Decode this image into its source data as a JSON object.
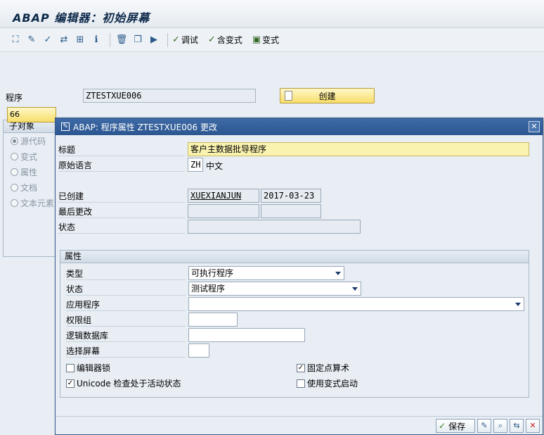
{
  "window": {
    "title": "ABAP 编辑器：初始屏幕"
  },
  "toolbar": {
    "debug_label": "调试",
    "with_variant_label": "含变式",
    "variant_label": "变式"
  },
  "main": {
    "program_label": "程序",
    "program_value": "ZTESTXUE006",
    "create_label": "创建",
    "subobjects_header": "子对象",
    "subobjects": [
      "源代码",
      "变式",
      "属性",
      "文档",
      "文本元素"
    ],
    "subobject_button": "66"
  },
  "dialog": {
    "title": "ABAP: 程序属性 ZTESTXUE006 更改",
    "title_label": "标题",
    "title_value": "客户主数据批导程序",
    "orig_lang_label": "原始语言",
    "orig_lang_code": "ZH",
    "orig_lang_name": "中文",
    "created_label": "已创建",
    "created_by": "XUEXIANJUN",
    "created_date": "2017-03-23",
    "last_changed_label": "最后更改",
    "status_label": "状态",
    "attributes": {
      "header": "属性",
      "type_label": "类型",
      "type_value": "可执行程序",
      "status_label": "状态",
      "status_value": "测试程序",
      "application_label": "应用程序",
      "authgroup_label": "权限组",
      "logical_db_label": "逻辑数据库",
      "selection_screen_label": "选择屏幕",
      "editor_lock_label": "编辑器锁",
      "fixed_point_label": "固定点算术",
      "unicode_label": "Unicode 检查处于活动状态",
      "start_variant_label": "使用变式启动",
      "editor_lock": false,
      "fixed_point": true,
      "unicode": true,
      "start_variant": false
    },
    "save_label": "保存"
  }
}
